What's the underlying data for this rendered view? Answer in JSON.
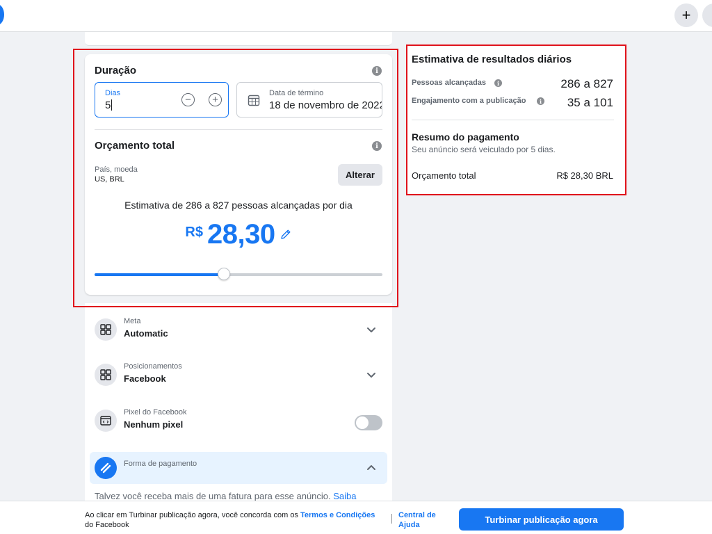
{
  "duration": {
    "title": "Duração",
    "days_label": "Dias",
    "days_value": "5",
    "end_date_label": "Data de término",
    "end_date_value": "18 de novembro de 2022"
  },
  "budget": {
    "title": "Orçamento total",
    "country_currency_label": "País, moeda",
    "country_currency_value": "US, BRL",
    "change_button": "Alterar",
    "estimate_text": "Estimativa de 286 a 827 pessoas alcançadas por dia",
    "currency_symbol": "R$",
    "amount": "28,30",
    "slider_fraction": 0.45
  },
  "settings": {
    "goal": {
      "label": "Meta",
      "value": "Automatic"
    },
    "placements": {
      "label": "Posicionamentos",
      "value": "Facebook"
    },
    "pixel": {
      "label": "Pixel do Facebook",
      "value": "Nenhum pixel",
      "enabled": false
    },
    "payment": {
      "label": "Forma de pagamento"
    },
    "note_text": "Talvez você receba mais de uma fatura para esse anúncio.",
    "note_link": "Saiba"
  },
  "daily_results": {
    "title": "Estimativa de resultados diários",
    "reach_label": "Pessoas alcançadas",
    "reach_value": "286 a 827",
    "engagement_label": "Engajamento com a publicação",
    "engagement_value": "35 a 101"
  },
  "payment_summary": {
    "title": "Resumo do pagamento",
    "description": "Seu anúncio será veiculado por 5 dias.",
    "total_label": "Orçamento total",
    "total_value": "R$ 28,30 BRL"
  },
  "footer": {
    "terms_prefix": "Ao clicar em Turbinar publicação agora, você concorda com os",
    "terms_link": "Termos e Condições",
    "terms_suffix": "do Facebook",
    "help_link": "Central de Ajuda",
    "boost_button": "Turbinar publicação agora"
  },
  "colors": {
    "accent": "#1877f2",
    "highlight": "#e0121b"
  },
  "icons": [
    "plus-icon",
    "info-icon",
    "minus-circle-icon",
    "plus-circle-icon",
    "calendar-icon",
    "pencil-icon",
    "goal-grid-icon",
    "placements-grid-icon",
    "pixel-code-icon",
    "payment-card-icon",
    "chevron-down-icon",
    "chevron-up-icon"
  ]
}
